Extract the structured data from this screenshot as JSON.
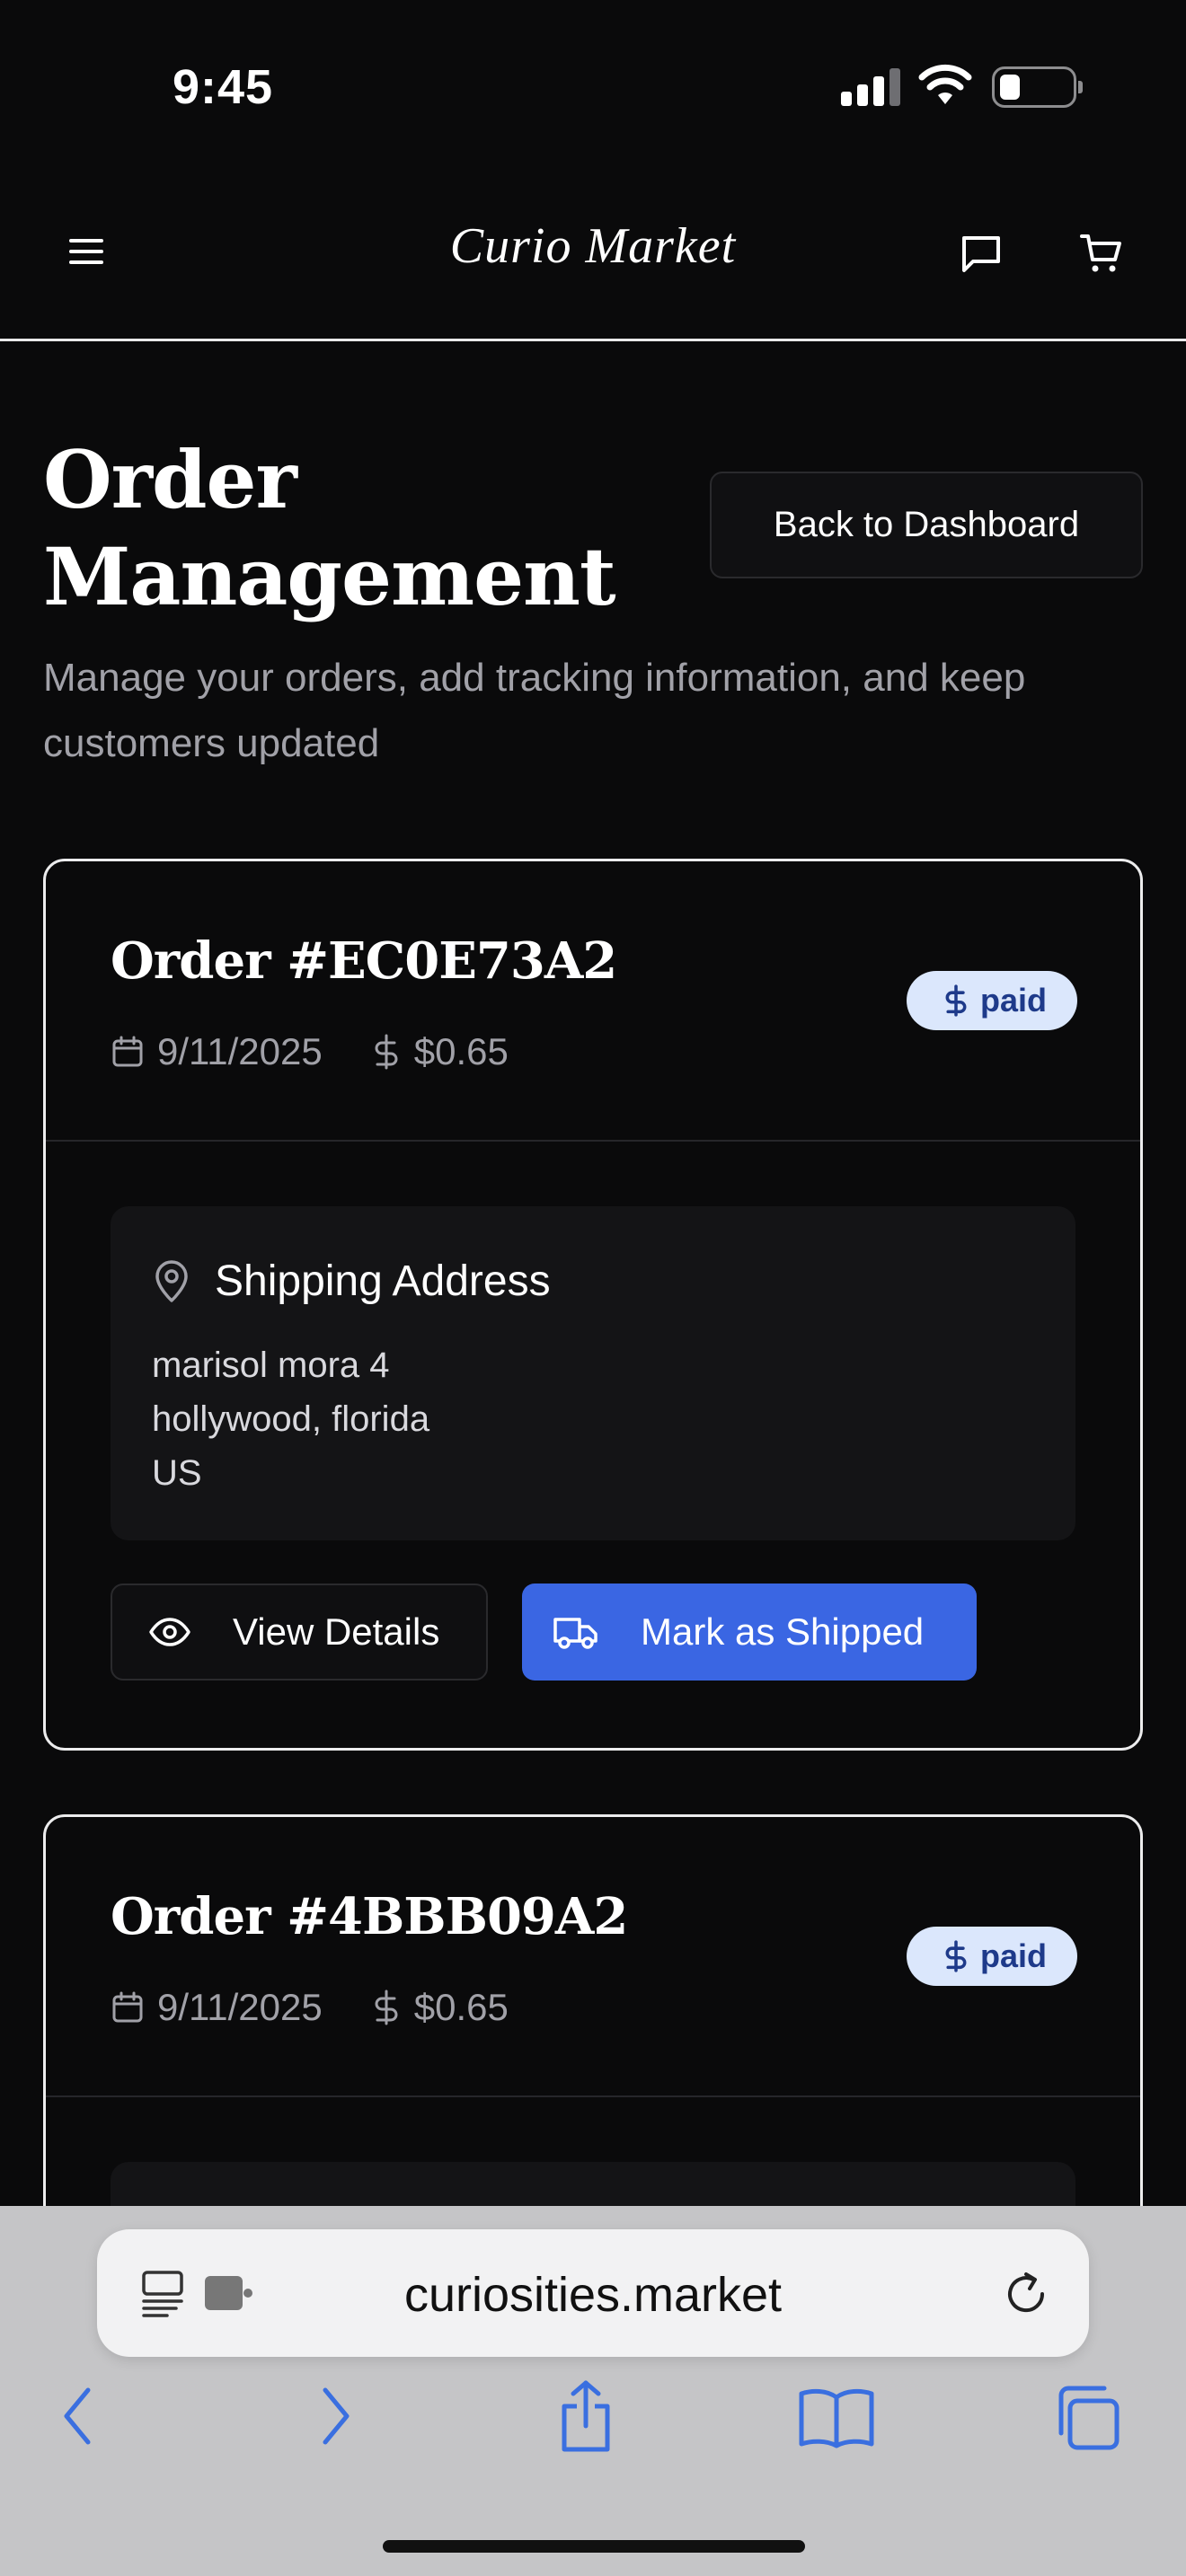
{
  "status_bar": {
    "time": "9:45"
  },
  "nav": {
    "logo": "Curio Market",
    "menu_icon": "menu-icon",
    "chat_icon": "chat-icon",
    "cart_icon": "cart-icon"
  },
  "page": {
    "title": "Order Management",
    "subtitle": "Manage your orders, add tracking information, and keep customers updated",
    "back_button": "Back to Dashboard"
  },
  "orders": [
    {
      "title": "Order #EC0E73A2",
      "date": "9/11/2025",
      "amount": "$0.65",
      "status": "paid",
      "shipping_heading": "Shipping Address",
      "address_line1": "marisol mora 4",
      "address_line2": "hollywood, florida",
      "address_line3": "US",
      "view_label": "View Details",
      "ship_label": "Mark as Shipped"
    },
    {
      "title": "Order #4BBB09A2",
      "date": "9/11/2025",
      "amount": "$0.65",
      "status": "paid"
    }
  ],
  "browser": {
    "url": "curiosities.market"
  },
  "colors": {
    "background": "#0a0a0b",
    "accent": "#3a66e3",
    "badge_bg": "#dbe7fc",
    "badge_text": "#1e3a8a",
    "muted_text": "#a1a1a8"
  }
}
